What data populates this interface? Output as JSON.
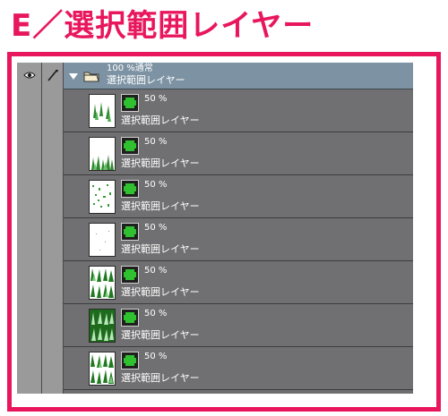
{
  "heading": "E／選択範囲レイヤー",
  "folder": {
    "opacity_mode": "100 %通常",
    "name": "選択範囲レイヤー"
  },
  "layers": [
    {
      "opacity": "50 %",
      "name": "選択範囲レイヤー",
      "thumbnail": "sparse-grass"
    },
    {
      "opacity": "50 %",
      "name": "選択範囲レイヤー",
      "thumbnail": "bottom-grass"
    },
    {
      "opacity": "50 %",
      "name": "選択範囲レイヤー",
      "thumbnail": "scattered-dots"
    },
    {
      "opacity": "50 %",
      "name": "選択範囲レイヤー",
      "thumbnail": "faint-dots"
    },
    {
      "opacity": "50 %",
      "name": "選択範囲レイヤー",
      "thumbnail": "grass-pattern"
    },
    {
      "opacity": "50 %",
      "name": "選択範囲レイヤー",
      "thumbnail": "dense-grass"
    },
    {
      "opacity": "50 %",
      "name": "選択範囲レイヤー",
      "thumbnail": "grass-pattern"
    }
  ],
  "icons": {
    "visibility": "eye-icon",
    "lock": "brush-icon",
    "expand": "triangle-down-icon",
    "folder": "folder-icon",
    "layer_type": "selection-layer-icon"
  },
  "colors": {
    "heading": "#e8175d",
    "frame": "#e8175d",
    "panel": "#6e6e70",
    "folder_row": "#7d93a3",
    "selection_green": "#2fc12f"
  }
}
